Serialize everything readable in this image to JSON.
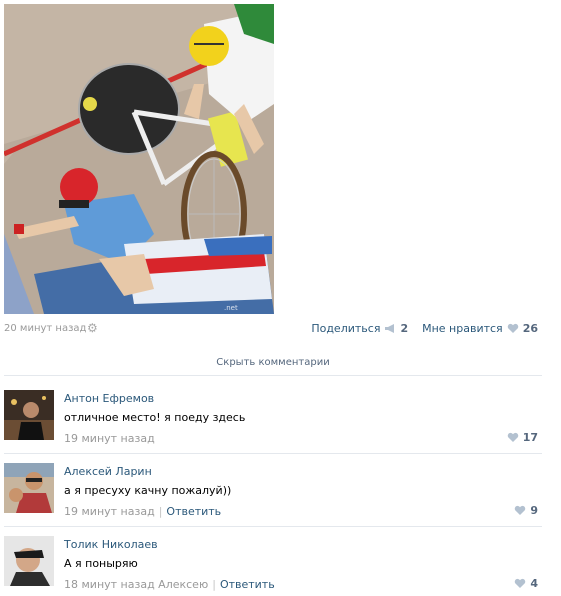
{
  "post": {
    "time": "20 минут назад",
    "share_label": "Поделиться",
    "share_count": "2",
    "like_label": "Мне нравится",
    "like_count": "26"
  },
  "hide_comments_label": "Скрыть комментарии",
  "comments": [
    {
      "author": "Антон Ефремов",
      "text": "отличное место! я поеду здесь",
      "time": "19 минут назад",
      "reply_label": "",
      "likes": "17"
    },
    {
      "author": "Алексей Ларин",
      "text": "а я пресуху качну пожалуй))",
      "time": "19 минут назад",
      "reply_label": "Ответить",
      "likes": "9"
    },
    {
      "author": "Толик Николаев",
      "text": "А я поныряю",
      "time": "18 минут назад Алексею",
      "reply_label": "Ответить",
      "likes": "4"
    }
  ],
  "colors": {
    "link": "#2b587a",
    "muted": "#999999",
    "count": "#55677d",
    "divider": "#e4e8ed"
  },
  "icons": {
    "settings": "gear-icon",
    "share": "megaphone-icon",
    "like": "heart-icon"
  }
}
